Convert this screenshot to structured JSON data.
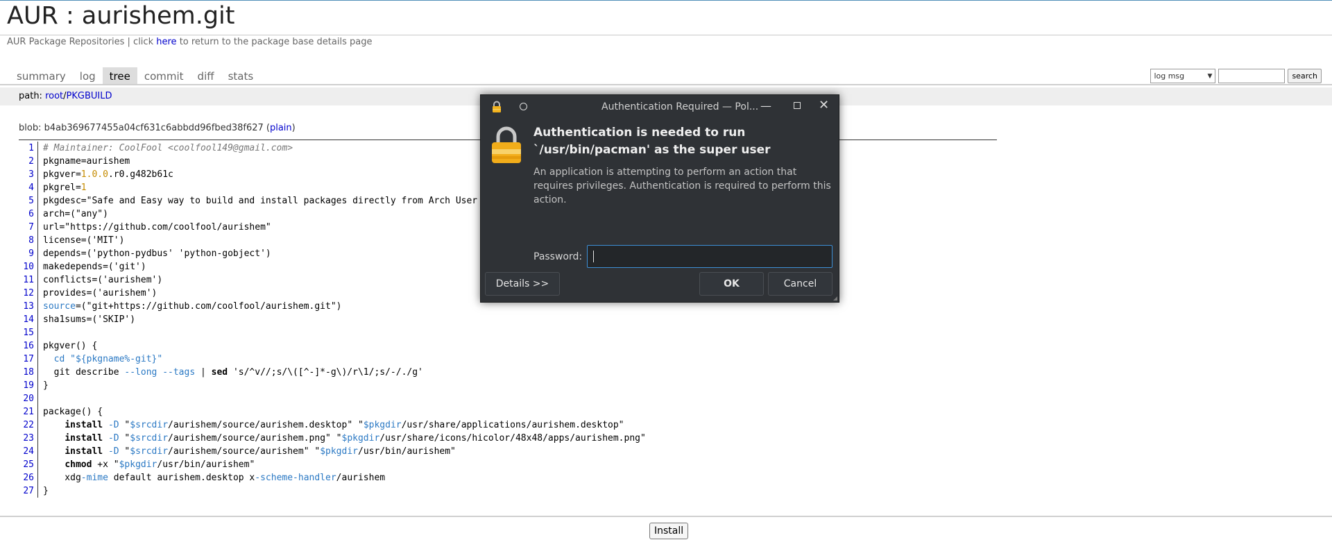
{
  "header": {
    "title": "AUR : aurishem.git",
    "subtitle_prefix": "AUR Package Repositories | click",
    "subtitle_link": "here",
    "subtitle_suffix": "to return to the package base details page"
  },
  "tabs": [
    "summary",
    "log",
    "tree",
    "commit",
    "diff",
    "stats"
  ],
  "active_tab": "tree",
  "search": {
    "select_value": "log msg",
    "input_value": "",
    "button_label": "search"
  },
  "path": {
    "label": "path:",
    "root_link": "root",
    "sep": "/",
    "file_link": "PKGBUILD"
  },
  "blob": {
    "prefix": "blob: b4ab369677455a04cf631c6abbdd96fbed38f627 (",
    "plain_link": "plain",
    "suffix": ")"
  },
  "code": {
    "line_numbers": [
      "1",
      "2",
      "3",
      "4",
      "5",
      "6",
      "7",
      "8",
      "9",
      "10",
      "11",
      "12",
      "13",
      "14",
      "15",
      "16",
      "17",
      "18",
      "19",
      "20",
      "21",
      "22",
      "23",
      "24",
      "25",
      "26",
      "27"
    ],
    "l1": "# Maintainer: CoolFool <coolfool149@gmail.com>",
    "l2": "pkgname=aurishem",
    "l3a": "pkgver=",
    "l3b": "1.0.0",
    "l3c": ".r0.g482b61c",
    "l4a": "pkgrel=",
    "l4b": "1",
    "l5": "pkgdesc=\"Safe and Easy way to build and install packages directly from Arch User Repository\"",
    "l6": "arch=(\"any\")",
    "l7": "url=\"https://github.com/coolfool/aurishem\"",
    "l8": "license=('MIT')",
    "l9": "depends=('python-pydbus' 'python-gobject')",
    "l10": "makedepends=('git')",
    "l11": "conflicts=('aurishem')",
    "l12": "provides=('aurishem')",
    "l13a": "source",
    "l13b": "=(\"git+https://github.com/coolfool/aurishem.git\")",
    "l14": "sha1sums=('SKIP')",
    "l15": "",
    "l16": "pkgver() {",
    "l17a": "  ",
    "l17b": "cd \"${pkgname%-git}\"",
    "l18a": "  git describe ",
    "l18b": "--long --tags",
    "l18c": " | ",
    "l18d": "sed",
    "l18e": " 's/^v//;s/\\([^-]*-g\\)/r\\1/;s/-/./g'",
    "l19": "}",
    "l20": "",
    "l21": "package() {",
    "l22a": "    ",
    "l22b": "install",
    "l22c": " ",
    "l22d": "-D",
    "l22e": " \"",
    "l22f": "$srcdir",
    "l22g": "/aurishem/source/aurishem.desktop\" \"",
    "l22h": "$pkgdir",
    "l22i": "/usr/share/applications/aurishem.desktop\"",
    "l23a": "    ",
    "l23b": "install",
    "l23c": " ",
    "l23d": "-D",
    "l23e": " \"",
    "l23f": "$srcdir",
    "l23g": "/aurishem/source/aurishem.png\" \"",
    "l23h": "$pkgdir",
    "l23i": "/usr/share/icons/hicolor/48x48/apps/aurishem.png\"",
    "l24a": "    ",
    "l24b": "install",
    "l24c": " ",
    "l24d": "-D",
    "l24e": " \"",
    "l24f": "$srcdir",
    "l24g": "/aurishem/source/aurishem\" \"",
    "l24h": "$pkgdir",
    "l24i": "/usr/bin/aurishem\"",
    "l25a": "    ",
    "l25b": "chmod",
    "l25c": " +x \"",
    "l25d": "$pkgdir",
    "l25e": "/usr/bin/aurishem\"",
    "l26a": "    xdg",
    "l26b": "-mime",
    "l26c": " default aurishem.desktop x",
    "l26d": "-scheme-handler",
    "l26e": "/aurishem",
    "l27": "}"
  },
  "install_button": "Install",
  "dialog": {
    "title": "Authentication Required — Pol...",
    "heading": "Authentication is needed to run `/usr/bin/pacman' as the super user",
    "body": "An application is attempting to perform an action that requires privileges. Authentication is required to perform this action.",
    "password_label": "Password:",
    "password_value": "",
    "details_label": "Details >>",
    "ok_label": "OK",
    "cancel_label": "Cancel",
    "icons": [
      "lock-icon",
      "pin-icon",
      "minimize-icon",
      "maximize-icon",
      "close-icon"
    ],
    "accent": "#3d8fd6"
  },
  "colors": {
    "link": "#0000cc",
    "line_number": "#0000cc",
    "comment": "#777777",
    "number": "#c58b00",
    "variable": "#2b79c4"
  }
}
